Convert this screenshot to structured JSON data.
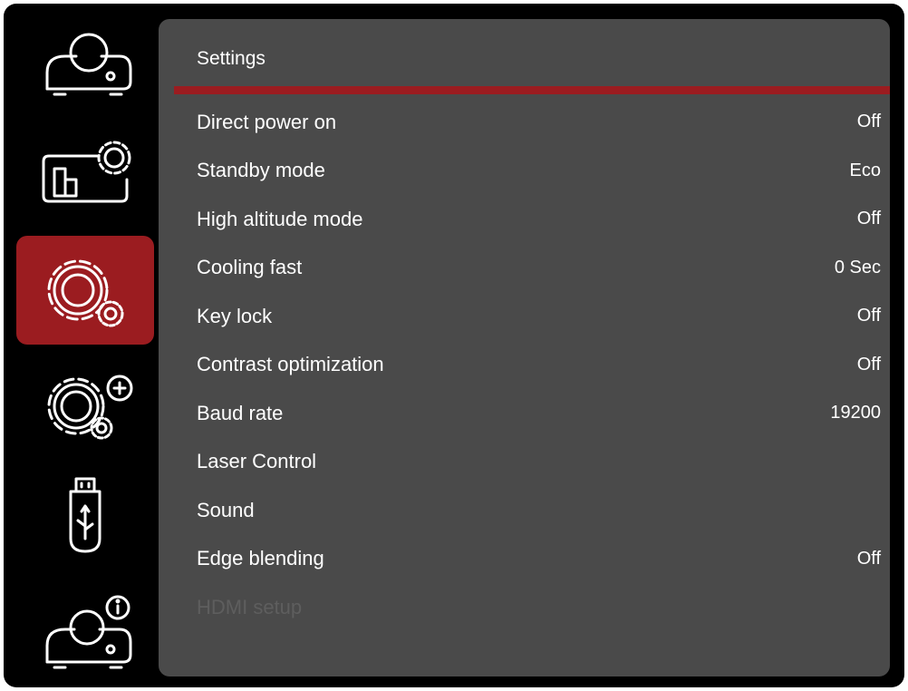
{
  "sidebar": {
    "items": [
      {
        "icon": "projector-icon",
        "active": false
      },
      {
        "icon": "display-settings-icon",
        "active": false
      },
      {
        "icon": "settings-gear-icon",
        "active": true
      },
      {
        "icon": "advanced-settings-icon",
        "active": false
      },
      {
        "icon": "usb-icon",
        "active": false
      },
      {
        "icon": "projector-info-icon",
        "active": false
      }
    ]
  },
  "panel": {
    "title": "Settings",
    "items": [
      {
        "label": "Direct power on",
        "value": "Off"
      },
      {
        "label": "Standby mode",
        "value": "Eco"
      },
      {
        "label": "High altitude mode",
        "value": "Off"
      },
      {
        "label": "Cooling fast",
        "value": "0 Sec"
      },
      {
        "label": "Key lock",
        "value": "Off"
      },
      {
        "label": "Contrast optimization",
        "value": "Off"
      },
      {
        "label": "Baud rate",
        "value": "19200"
      },
      {
        "label": "Laser Control",
        "value": ""
      },
      {
        "label": "Sound",
        "value": ""
      },
      {
        "label": "Edge blending",
        "value": "Off"
      },
      {
        "label": "HDMI setup",
        "value": "",
        "disabled": true
      }
    ]
  },
  "colors": {
    "accent": "#9b1c20",
    "panel_bg": "#4a4a4a",
    "frame_bg": "#000000",
    "text": "#ffffff",
    "disabled_text": "#5e5e5e"
  }
}
